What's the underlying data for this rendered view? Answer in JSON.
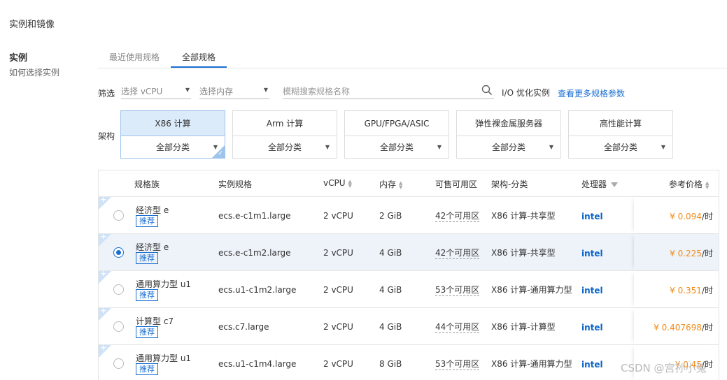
{
  "page": {
    "section_title": "实例和镜像",
    "side_title": "实例",
    "side_link": "如何选择实例"
  },
  "tabs": [
    "最近使用规格",
    "全部规格"
  ],
  "filter": {
    "label": "筛选",
    "vcpu_placeholder": "选择 vCPU",
    "mem_placeholder": "选择内存",
    "search_placeholder": "模糊搜索规格名称",
    "io_label": "I/O 优化实例",
    "more_link": "查看更多规格参数"
  },
  "arch": {
    "label": "架构",
    "cards": [
      {
        "name": "X86 计算",
        "sub": "全部分类",
        "selected": true
      },
      {
        "name": "Arm 计算",
        "sub": "全部分类",
        "selected": false
      },
      {
        "name": "GPU/FPGA/ASIC",
        "sub": "全部分类",
        "selected": false
      },
      {
        "name": "弹性裸金属服务器",
        "sub": "全部分类",
        "selected": false
      },
      {
        "name": "高性能计算",
        "sub": "全部分类",
        "selected": false
      }
    ]
  },
  "table": {
    "headers": {
      "family": "规格族",
      "spec": "实例规格",
      "vcpu": "vCPU",
      "mem": "内存",
      "zones": "可售可用区",
      "arch": "架构-分类",
      "cpu": "处理器",
      "price": "参考价格"
    },
    "badge": "推荐",
    "processor": "intel",
    "rows": [
      {
        "family": "经济型 e",
        "spec": "ecs.e-c1m1.large",
        "vcpu": "2 vCPU",
        "mem": "2 GiB",
        "zones": "42个可用区",
        "arch": "X86 计算-共享型",
        "price": "¥ 0.094",
        "unit": "/时",
        "selected": false
      },
      {
        "family": "经济型 e",
        "spec": "ecs.e-c1m2.large",
        "vcpu": "2 vCPU",
        "mem": "4 GiB",
        "zones": "42个可用区",
        "arch": "X86 计算-共享型",
        "price": "¥ 0.225",
        "unit": "/时",
        "selected": true
      },
      {
        "family": "通用算力型 u1",
        "spec": "ecs.u1-c1m2.large",
        "vcpu": "2 vCPU",
        "mem": "4 GiB",
        "zones": "53个可用区",
        "arch": "X86 计算-通用算力型",
        "price": "¥ 0.351",
        "unit": "/时",
        "selected": false
      },
      {
        "family": "计算型 c7",
        "spec": "ecs.c7.large",
        "vcpu": "2 vCPU",
        "mem": "4 GiB",
        "zones": "44个可用区",
        "arch": "X86 计算-计算型",
        "price": "¥ 0.407698",
        "unit": "/时",
        "selected": false
      },
      {
        "family": "通用算力型 u1",
        "spec": "ecs.u1-c1m4.large",
        "vcpu": "2 vCPU",
        "mem": "8 GiB",
        "zones": "53个可用区",
        "arch": "X86 计算-通用算力型",
        "price": "¥ 0.45",
        "unit": "/时",
        "selected": false
      }
    ]
  },
  "watermark": "CSDN @宫孙小兔",
  "colors": {
    "accent": "#1a6fd1",
    "price": "#f08c1a",
    "selected_row": "#eef3fa"
  }
}
